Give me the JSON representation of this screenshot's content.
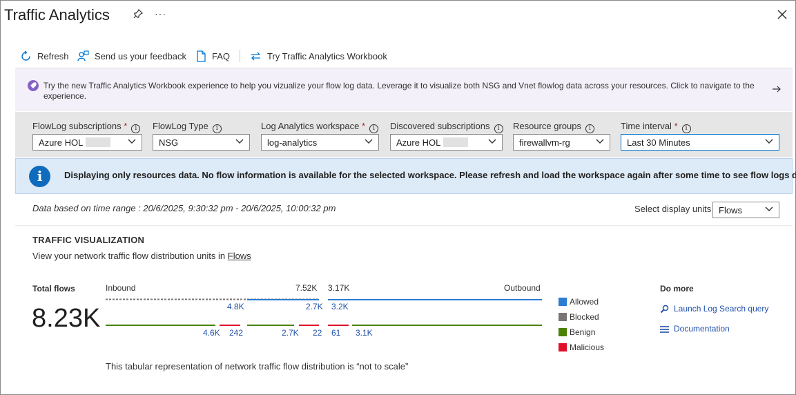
{
  "header": {
    "title": "Traffic Analytics",
    "more": "···"
  },
  "toolbar": {
    "refresh": "Refresh",
    "feedback": "Send us your feedback",
    "faq": "FAQ",
    "workbook": "Try Traffic Analytics Workbook"
  },
  "banner": {
    "text": "Try the new Traffic Analytics Workbook experience to help you vizualize your flow log data. Leverage it to visualize both NSG and Vnet flowlog data across your resources. Click to navigate to the experience."
  },
  "filters": [
    {
      "label": "FlowLog subscriptions",
      "required": "*",
      "value": "Azure HOL"
    },
    {
      "label": "FlowLog Type",
      "required": "",
      "value": "NSG"
    },
    {
      "label": "Log Analytics workspace",
      "required": "*",
      "value": "log-analytics"
    },
    {
      "label": "Discovered subscriptions",
      "required": "",
      "value": "Azure HOL"
    },
    {
      "label": "Resource groups",
      "required": "",
      "value": "firewallvm-rg"
    },
    {
      "label": "Time interval",
      "required": "*",
      "value": "Last 30 Minutes"
    }
  ],
  "info": {
    "icon": "i",
    "text": "Displaying only resources data. No flow information is available for the selected workspace. Please refresh and load the workspace again after some time to see flow logs data."
  },
  "time_range": "Data based on time range : 20/6/2025, 9:30:32 pm - 20/6/2025, 10:00:32 pm",
  "display_units": {
    "label": "Select display units",
    "value": "Flows"
  },
  "visualization": {
    "title": "TRAFFIC VISUALIZATION",
    "subtitle_prefix": "View your network traffic flow distribution units in",
    "subtitle_link": "Flows",
    "total_label": "Total flows",
    "total_value": "8.23K",
    "footnote": "This tabular representation of network traffic flow distribution is “not to scale”"
  },
  "chart_data": {
    "type": "table",
    "inbound_label": "Inbound",
    "outbound_label": "Outbound",
    "inbound_total": "7.52K",
    "outbound_total": "3.17K",
    "top_values": [
      "4.8K",
      "2.7K",
      "3.2K"
    ],
    "bottom_values": [
      "4.6K",
      "242",
      "2.7K",
      "22",
      "61",
      "3.1K"
    ],
    "legend": [
      {
        "name": "Allowed",
        "color": "#2b7cd3"
      },
      {
        "name": "Blocked",
        "color": "#7a7574"
      },
      {
        "name": "Benign",
        "color": "#498205"
      },
      {
        "name": "Malicious",
        "color": "#e0102a"
      }
    ]
  },
  "do_more": {
    "title": "Do more",
    "links": [
      "Launch Log Search query",
      "Documentation"
    ]
  }
}
